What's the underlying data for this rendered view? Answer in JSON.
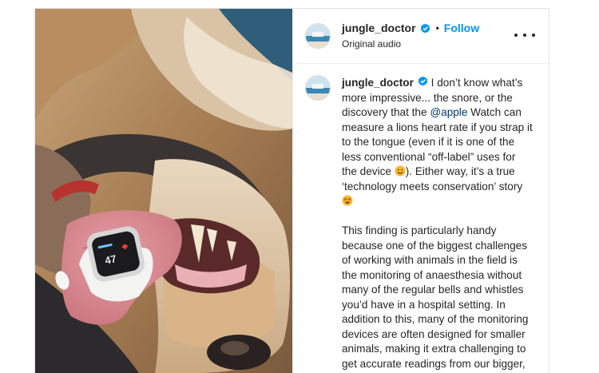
{
  "post": {
    "username": "jungle_doctor",
    "follow_label": "Follow",
    "separator": "•",
    "audio_label": "Original audio",
    "caption": {
      "username": "jungle_doctor",
      "part1": " I don’t know what’s more impressive... the snore, or the discovery that the ",
      "mention": "@apple",
      "part2": " Watch can measure a lions heart rate if you strap it to the tongue (even if it is one of the less conventional “off-label” uses for the device ",
      "part3": "). Either way, it’s a true ‘technology meets conservation’ story ",
      "paragraph2": "This finding is particularly handy because one of the biggest challenges of working with animals in the field is the monitoring of anaesthesia without many of the regular bells and whistles you’d have in a hospital setting. In addition to this, many of the monitoring devices are often designed for smaller animals, making it extra challenging to get accurate readings from our bigger, spikey or"
    },
    "watch_readout": "47",
    "icons": [
      "verified-badge-icon",
      "more-options-icon",
      "smiling-face-emoji",
      "star-struck-emoji"
    ],
    "colors": {
      "link_blue": "#0095f6",
      "mention_blue": "#00376b",
      "text": "#262626",
      "verified": "#0095f6"
    }
  }
}
